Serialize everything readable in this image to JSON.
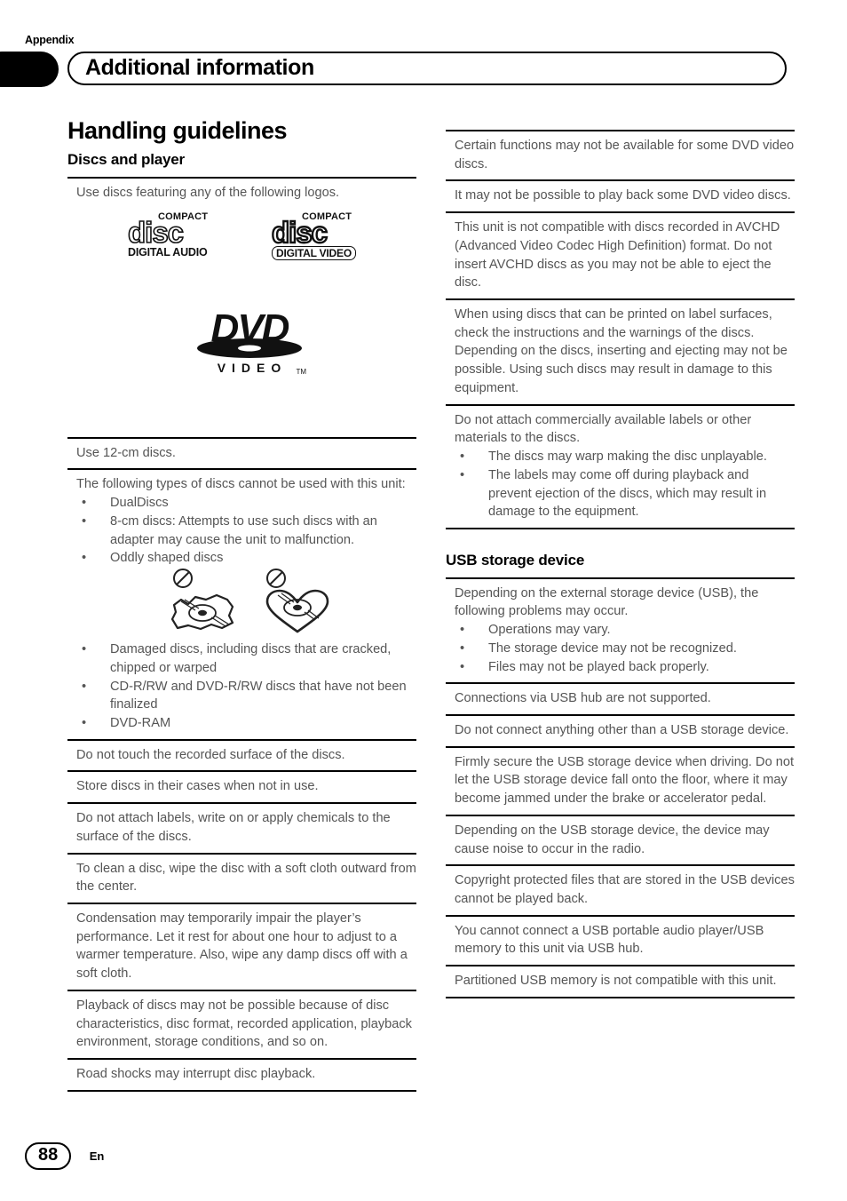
{
  "header": {
    "appendix_label": "Appendix",
    "title": "Additional information"
  },
  "footer": {
    "page_number": "88",
    "language": "En"
  },
  "left_column": {
    "h1": "Handling guidelines",
    "h2": "Discs and player",
    "intro_note": "Use discs featuring any of the following logos.",
    "logos": [
      {
        "name": "compact-disc-digital-audio-logo",
        "top": "COMPACT",
        "word": "disc",
        "bottom": "DIGITAL AUDIO"
      },
      {
        "name": "compact-disc-digital-video-logo",
        "top": "COMPACT",
        "word": "disc",
        "bottom": "DIGITAL VIDEO"
      },
      {
        "name": "dvd-video-logo",
        "word": "DVD",
        "sub": "VIDEO",
        "tm": "TM"
      }
    ],
    "notes": [
      {
        "text": "Use 12-cm discs."
      },
      {
        "text": "The following types of discs cannot be used with this unit:",
        "bullets": [
          "DualDiscs",
          "8-cm discs: Attempts to use such discs with an adapter may cause the unit to malfunction.",
          "Oddly shaped discs"
        ],
        "has_shape_figures": true,
        "bullets_after": [
          "Damaged discs, including discs that are cracked, chipped or warped",
          "CD-R/RW and DVD-R/RW discs that have not been finalized",
          "DVD-RAM"
        ]
      },
      {
        "text": "Do not touch the recorded surface of the discs."
      },
      {
        "text": "Store discs in their cases when not in use."
      },
      {
        "text": "Do not attach labels, write on or apply chemicals to the surface of the discs."
      },
      {
        "text": "To clean a disc, wipe the disc with a soft cloth outward from the center."
      },
      {
        "text": "Condensation may temporarily impair the player’s performance. Let it rest for about one hour to adjust to a warmer temperature. Also, wipe any damp discs off with a soft cloth."
      },
      {
        "text": "Playback of discs may not be possible because of disc characteristics, disc format, recorded application, playback environment, storage conditions, and so on."
      },
      {
        "text": "Road shocks may interrupt disc playback."
      }
    ]
  },
  "right_column": {
    "disc_notes": [
      {
        "text": "Certain functions may not be available for some DVD video discs."
      },
      {
        "text": "It may not be possible to play back some DVD video discs."
      },
      {
        "text": "This unit is not compatible with discs recorded in AVCHD (Advanced Video Codec High Definition) format. Do not insert AVCHD discs as you may not be able to eject the disc."
      },
      {
        "text": "When using discs that can be printed on label surfaces, check the instructions and the warnings of the discs. Depending on the discs, inserting and ejecting may not be possible. Using such discs may result in damage to this equipment."
      },
      {
        "text": "Do not attach commercially available labels or other materials to the discs.",
        "bullets": [
          "The discs may warp making the disc unplayable.",
          "The labels may come off during playback and prevent ejection of the discs, which may result in damage to the equipment."
        ]
      }
    ],
    "h2": "USB storage device",
    "usb_notes": [
      {
        "text": "Depending on the external storage device (USB), the following problems may occur.",
        "bullets": [
          "Operations may vary.",
          "The storage device may not be recognized.",
          "Files may not be played back properly."
        ]
      },
      {
        "text": "Connections via USB hub are not supported."
      },
      {
        "text": "Do not connect anything other than a USB storage device."
      },
      {
        "text": "Firmly secure the USB storage device when driving. Do not let the USB storage device fall onto the floor, where it may become jammed under the brake or accelerator pedal."
      },
      {
        "text": "Depending on the USB storage device, the device may cause noise to occur in the radio."
      },
      {
        "text": "Copyright protected files that are stored in the USB devices cannot be played back."
      },
      {
        "text": "You cannot connect a USB portable audio player/USB memory to this unit via USB hub."
      },
      {
        "text": "Partitioned USB memory is not compatible with this unit."
      }
    ]
  },
  "bullet_glyph": "•"
}
